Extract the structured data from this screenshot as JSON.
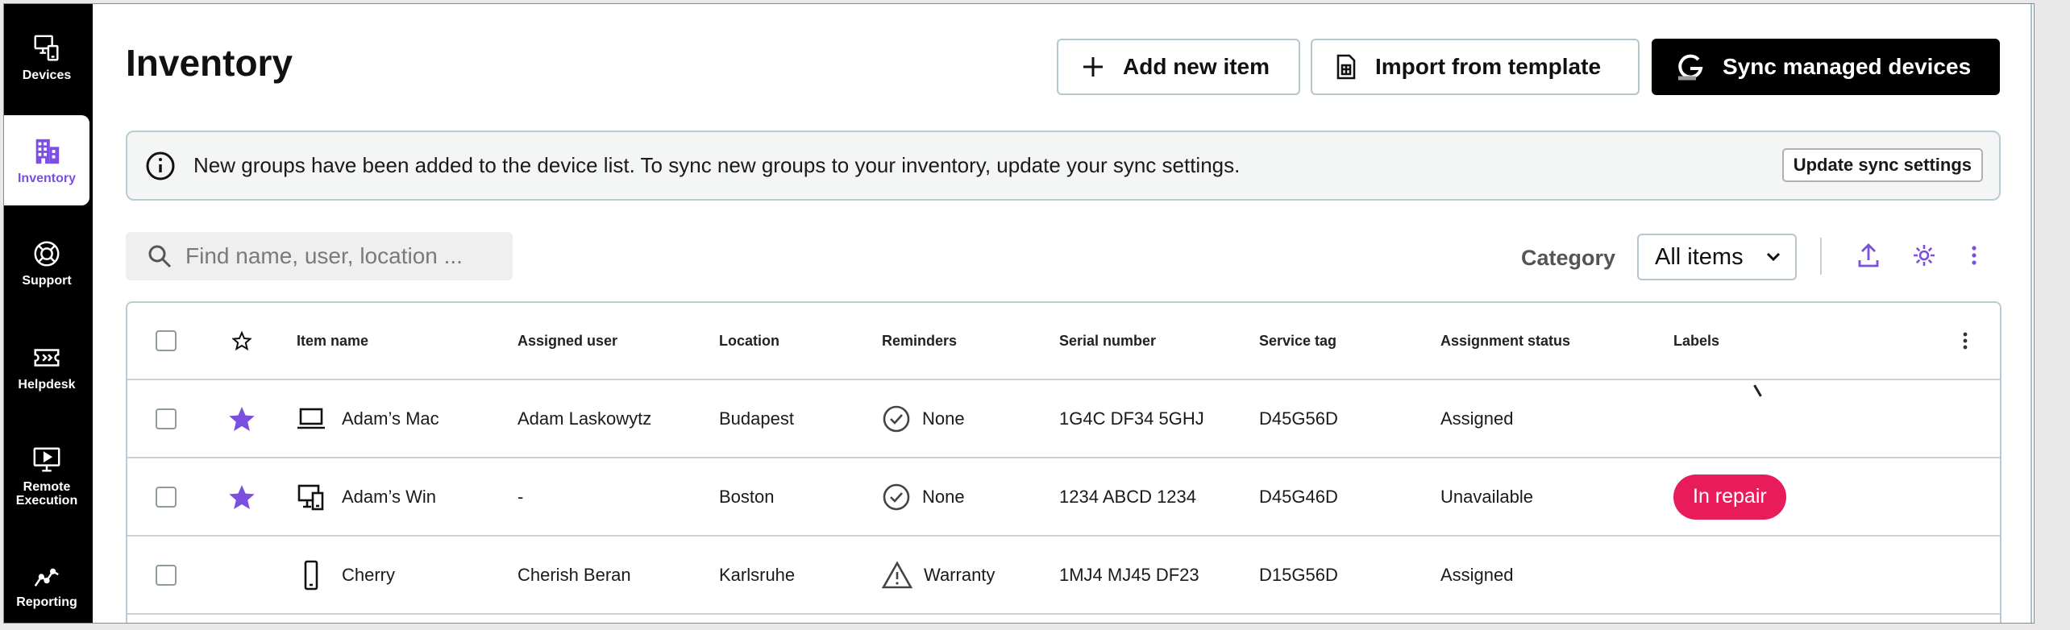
{
  "nav": [
    {
      "id": "devices",
      "label": "Devices",
      "icon": "devices-icon",
      "active": false
    },
    {
      "id": "inventory",
      "label": "Inventory",
      "icon": "building-icon",
      "active": true
    },
    {
      "id": "support",
      "label": "Support",
      "icon": "lifebuoy-icon",
      "active": false
    },
    {
      "id": "helpdesk",
      "label": "Helpdesk",
      "icon": "ticket-icon",
      "active": false
    },
    {
      "id": "remote",
      "label": "Remote Execution",
      "icon": "monitor-play-icon",
      "active": false
    },
    {
      "id": "reporting",
      "label": "Reporting",
      "icon": "line-chart-icon",
      "active": false
    }
  ],
  "header": {
    "title": "Inventory",
    "add_label": "Add new item",
    "import_label": "Import from template",
    "sync_label": "Sync managed devices"
  },
  "banner": {
    "message": "New groups have been added to the device list. To sync new groups to your inventory, update your sync settings.",
    "button_label": "Update sync settings"
  },
  "filters": {
    "search_placeholder": "Find name, user, location ...",
    "category_label": "Category",
    "category_value": "All items"
  },
  "table": {
    "columns": {
      "item_name": "Item name",
      "assigned_user": "Assigned user",
      "location": "Location",
      "reminders": "Reminders",
      "serial": "Serial number",
      "service_tag": "Service tag",
      "status": "Assignment status",
      "labels": "Labels"
    },
    "rows": [
      {
        "starred": true,
        "icon": "laptop-icon",
        "name": "Adam’s Mac",
        "user": "Adam Laskowytz",
        "location": "Budapest",
        "reminder_icon": "check-circle-icon",
        "reminder": "None",
        "serial": "1G4C DF34 5GHJ",
        "service_tag": "D45G56D",
        "status": "Assigned",
        "label": ""
      },
      {
        "starred": true,
        "icon": "desktop-icon",
        "name": "Adam’s Win",
        "user": "-",
        "location": "Boston",
        "reminder_icon": "check-circle-icon",
        "reminder": "None",
        "serial": "1234 ABCD 1234",
        "service_tag": "D45G46D",
        "status": "Unavailable",
        "label": "In repair"
      },
      {
        "starred": false,
        "icon": "phone-icon",
        "name": "Cherry",
        "user": "Cherish Beran",
        "location": "Karlsruhe",
        "reminder_icon": "warning-icon",
        "reminder": "Warranty",
        "serial": "1MJ4 MJ45 DF23",
        "service_tag": "D15G56D",
        "status": "Assigned",
        "label": ""
      }
    ]
  },
  "colors": {
    "accent": "#7b4fe0",
    "pill": "#e81c5a",
    "sidebar": "#000000"
  }
}
